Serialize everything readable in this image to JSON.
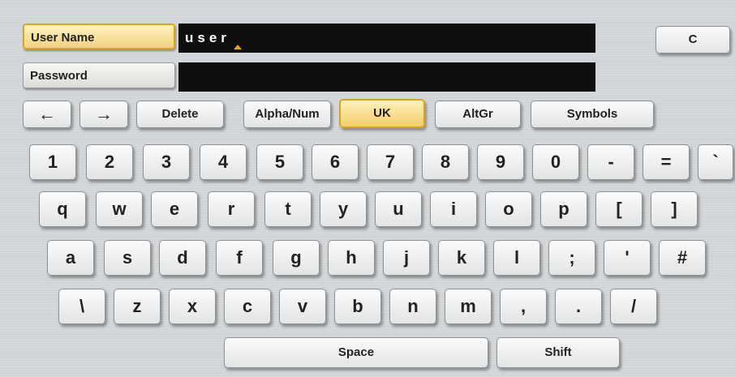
{
  "fields": {
    "username_label": "User Name",
    "username_value": "user",
    "password_label": "Password",
    "password_value": ""
  },
  "top_right_button": "C",
  "toolbar": {
    "left_arrow": "←",
    "right_arrow": "→",
    "delete": "Delete",
    "alpha_num": "Alpha/Num",
    "uk": "UK",
    "altgr": "AltGr",
    "symbols": "Symbols"
  },
  "keyboard": {
    "row1": [
      "1",
      "2",
      "3",
      "4",
      "5",
      "6",
      "7",
      "8",
      "9",
      "0",
      "-",
      "=",
      "`"
    ],
    "row2": [
      "q",
      "w",
      "e",
      "r",
      "t",
      "y",
      "u",
      "i",
      "o",
      "p",
      "[",
      "]"
    ],
    "row3": [
      "a",
      "s",
      "d",
      "f",
      "g",
      "h",
      "j",
      "k",
      "l",
      ";",
      "'",
      "#"
    ],
    "row4": [
      "\\",
      "z",
      "x",
      "c",
      "v",
      "b",
      "n",
      "m",
      ",",
      ".",
      "/"
    ]
  },
  "bottom": {
    "space": "Space",
    "shift": "Shift"
  },
  "colors": {
    "accent_yellow": "#f4cf6b",
    "accent_border": "#d9a520",
    "field_black": "#0e0e0c"
  }
}
